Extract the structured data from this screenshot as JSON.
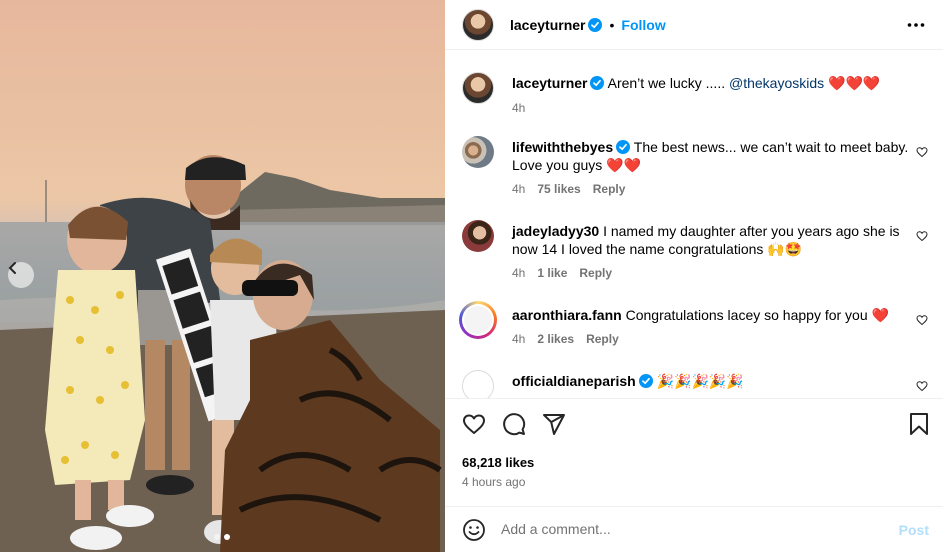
{
  "post": {
    "author": "laceyturner",
    "follow_label": "Follow",
    "separator": "•",
    "more_icon": "more-horizontal-icon",
    "caption": {
      "username": "laceyturner",
      "text": "Aren’t we lucky ..... ",
      "mention": "@thekayoskids",
      "emojis": "❤️❤️❤️",
      "time": "4h"
    },
    "likes": "68,218 likes",
    "time_ago": "4 hours ago",
    "add_comment_placeholder": "Add a comment...",
    "post_label": "Post"
  },
  "comments": [
    {
      "username": "lifewiththebyes",
      "verified": true,
      "text": "The best news... we can’t wait to meet baby. Love you guys ",
      "emojis": "❤️❤️",
      "time": "4h",
      "likes": "75 likes",
      "reply": "Reply"
    },
    {
      "username": "jadeyladyy30",
      "verified": false,
      "text": "I named my daughter after you years ago she is now 14 I loved the name congratulations ",
      "emojis": "🙌🤩",
      "time": "4h",
      "likes": "1 like",
      "reply": "Reply"
    },
    {
      "username": "aaronthiara.fann",
      "verified": false,
      "text": "Congratulations lacey so happy for you ",
      "emojis": "❤️",
      "time": "4h",
      "likes": "2 likes",
      "reply": "Reply"
    },
    {
      "username": "officialdianeparish",
      "verified": true,
      "text": "",
      "emojis": "🎉🎉🎉🎉🎉",
      "time": "",
      "likes": "",
      "reply": ""
    }
  ],
  "colors": {
    "accent": "#0095f6",
    "verified": "#0095f6",
    "muted": "#737373",
    "post_disabled": "#b2dffc",
    "heart": "#e0245e"
  },
  "carousel": {
    "dot_count": 2,
    "active_index": 1
  }
}
